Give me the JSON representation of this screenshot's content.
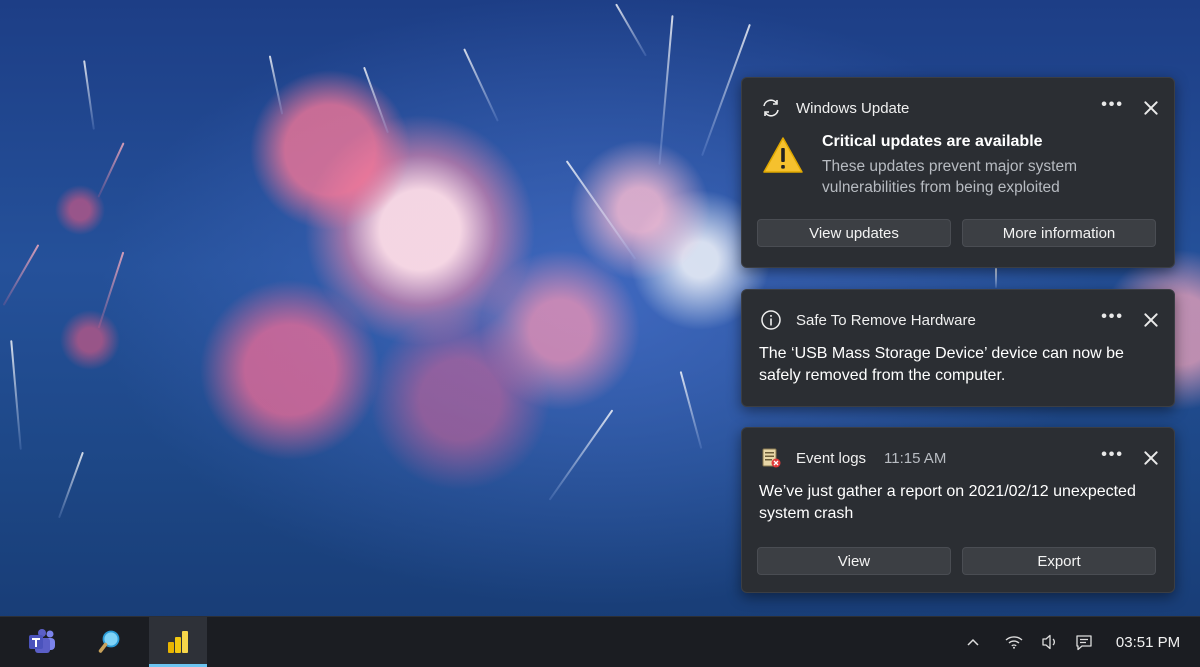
{
  "notifications": [
    {
      "app": "Windows Update",
      "icon": "refresh-icon",
      "title": "Critical updates are available",
      "body": "These updates prevent major system vulnerabilities from being exploited",
      "body_icon": "warning-icon",
      "buttons": [
        "View updates",
        "More information"
      ]
    },
    {
      "app": "Safe To Remove Hardware",
      "icon": "info-icon",
      "body": "The ‘USB Mass Storage Device’ device can now be safely removed from the computer."
    },
    {
      "app": "Event logs",
      "time": "11:15 AM",
      "icon": "event-log-icon",
      "body": "We’ve just gather a report on 2021/02/12 unexpected system crash",
      "buttons": [
        "View",
        "Export"
      ]
    }
  ],
  "more_glyph": "•••",
  "taskbar": {
    "apps": [
      "teams-icon",
      "search-icon",
      "power-bi-icon"
    ],
    "tray": [
      "chevron-up-icon",
      "wifi-icon",
      "volume-icon",
      "chat-icon"
    ],
    "clock": "03:51 PM"
  },
  "colors": {
    "toast_bg": "#2b2e33",
    "button_bg": "#3c3f44",
    "taskbar_bg": "#1b1d22",
    "active_indicator": "#6cc4f0"
  }
}
